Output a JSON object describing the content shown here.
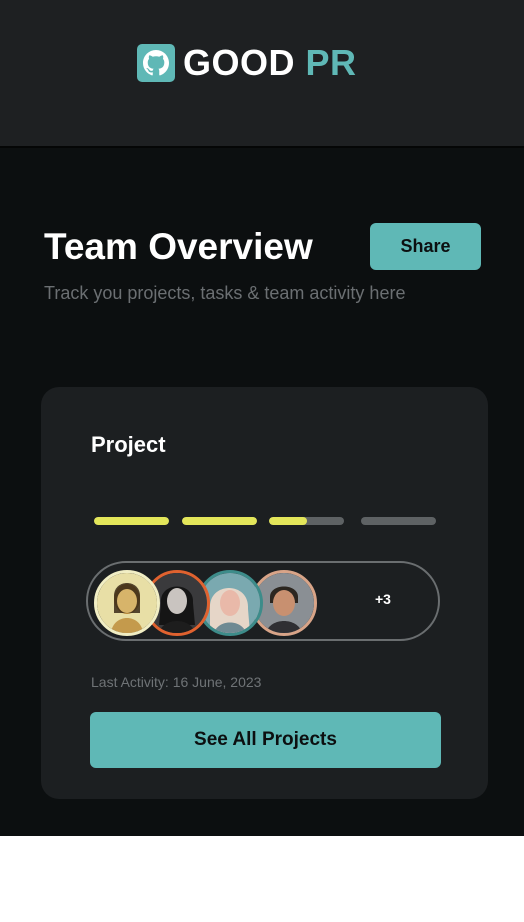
{
  "brand": {
    "icon": "github-icon",
    "word1": "GOOD",
    "word2": "PR",
    "accent": "#5fb8b6"
  },
  "header": {
    "title": "Team Overview",
    "share_label": "Share",
    "subtitle": "Track you projects, tasks & team activity here"
  },
  "card": {
    "title": "Project",
    "progress": [
      {
        "fill": 1.0,
        "color": "#e3e65a"
      },
      {
        "fill": 1.0,
        "color": "#e3e65a"
      },
      {
        "fill": 0.5,
        "color": "#e3e65a"
      },
      {
        "fill": 0.0,
        "color": "#e3e65a"
      }
    ],
    "avatars": [
      {
        "name": "avatar-1",
        "ring": "#f1eec4"
      },
      {
        "name": "avatar-2",
        "ring": "#e0622f"
      },
      {
        "name": "avatar-3",
        "ring": "#3d8c8a"
      },
      {
        "name": "avatar-4",
        "ring": "#d8a488"
      }
    ],
    "more_count": "+3",
    "last_activity": "Last Activity: 16 June, 2023",
    "cta_label": "See All Projects"
  }
}
